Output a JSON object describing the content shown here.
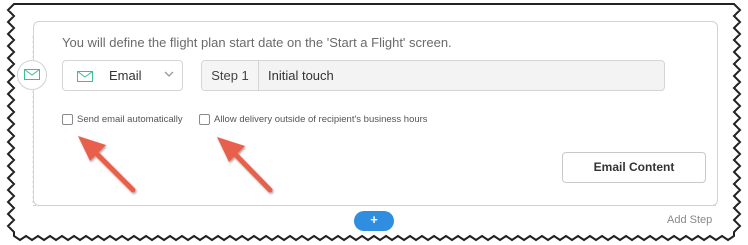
{
  "intro_text": "You will define the flight plan start date on the 'Start a Flight' screen.",
  "channel": {
    "icon": "envelope-icon",
    "selected": "Email",
    "accent": "#3fbf8f"
  },
  "step": {
    "prefix": "Step 1",
    "name": "Initial touch"
  },
  "options": {
    "send_auto_label": "Send email automatically",
    "send_auto_checked": false,
    "allow_outside_label": "Allow delivery outside of recipient's business hours",
    "allow_outside_checked": false
  },
  "buttons": {
    "email_content": "Email Content",
    "add_symbol": "+",
    "add_step": "Add Step"
  },
  "annotation_color": "#e8604c"
}
